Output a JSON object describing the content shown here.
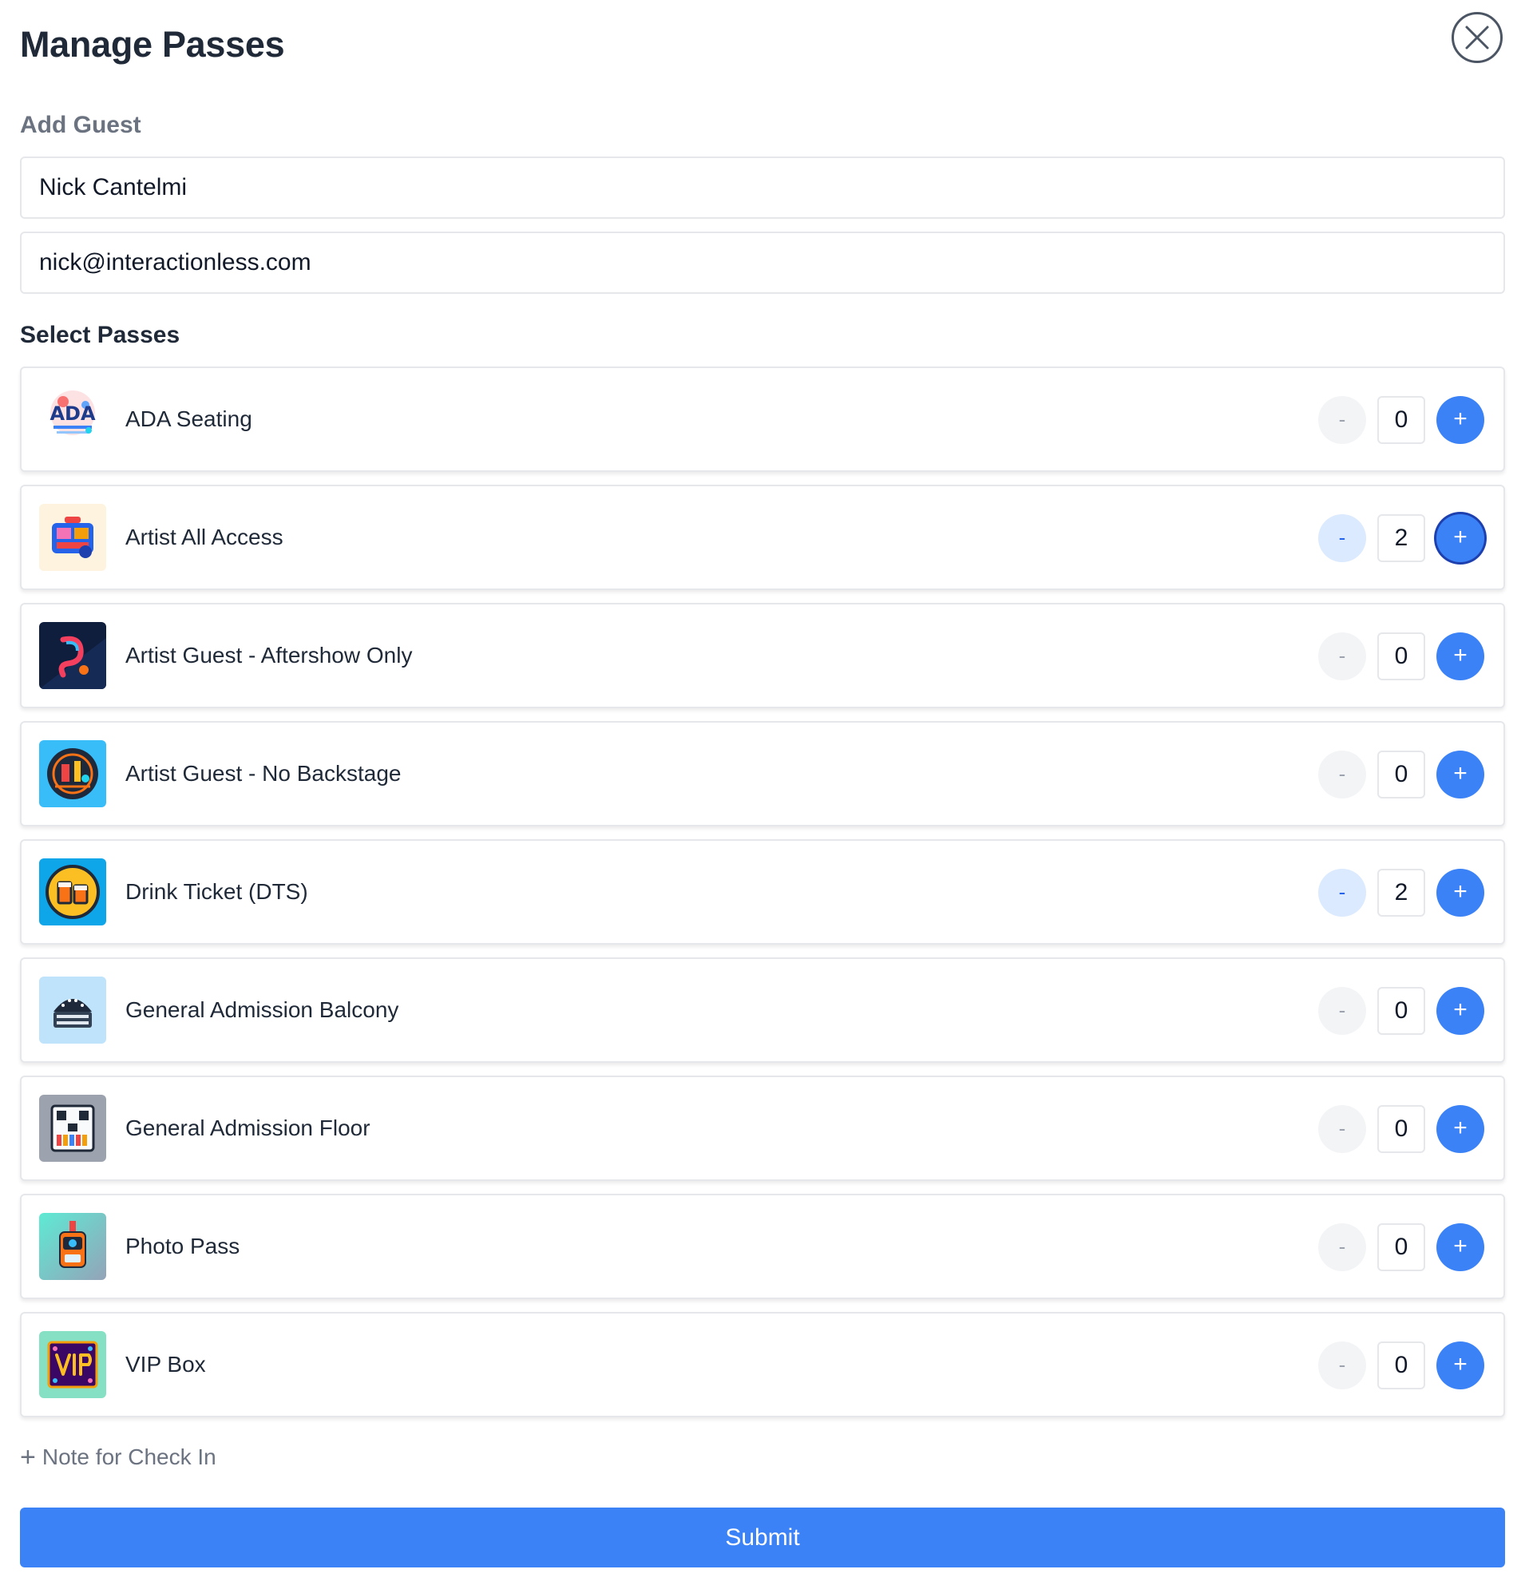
{
  "modal": {
    "title": "Manage Passes",
    "close_icon": "close-icon"
  },
  "guest": {
    "label": "Add Guest",
    "name_value": "Nick Cantelmi",
    "email_value": "nick@interactionless.com"
  },
  "passes": {
    "label": "Select Passes",
    "items": [
      {
        "name": "ADA Seating",
        "qty": "0",
        "icon": "ada-seating-icon",
        "minus": "-",
        "plus": "+"
      },
      {
        "name": "Artist All Access",
        "qty": "2",
        "icon": "artist-all-access-icon",
        "minus": "-",
        "plus": "+"
      },
      {
        "name": "Artist Guest - Aftershow Only",
        "qty": "0",
        "icon": "artist-guest-aftershow-icon",
        "minus": "-",
        "plus": "+"
      },
      {
        "name": "Artist Guest - No Backstage",
        "qty": "0",
        "icon": "artist-guest-no-backstage-icon",
        "minus": "-",
        "plus": "+"
      },
      {
        "name": "Drink Ticket (DTS)",
        "qty": "2",
        "icon": "drink-ticket-icon",
        "minus": "-",
        "plus": "+"
      },
      {
        "name": "General Admission Balcony",
        "qty": "0",
        "icon": "ga-balcony-icon",
        "minus": "-",
        "plus": "+"
      },
      {
        "name": "General Admission Floor",
        "qty": "0",
        "icon": "ga-floor-icon",
        "minus": "-",
        "plus": "+"
      },
      {
        "name": "Photo Pass",
        "qty": "0",
        "icon": "photo-pass-icon",
        "minus": "-",
        "plus": "+"
      },
      {
        "name": "VIP Box",
        "qty": "0",
        "icon": "vip-box-icon",
        "minus": "-",
        "plus": "+"
      }
    ]
  },
  "note": {
    "label": "Note for Check In",
    "glyph": "+"
  },
  "submit": {
    "label": "Submit"
  },
  "colors": {
    "primary": "#3b82f6",
    "minus_active_bg": "#dbeafe",
    "minus_inactive_bg": "#f3f4f6",
    "border": "#e5e7eb"
  }
}
